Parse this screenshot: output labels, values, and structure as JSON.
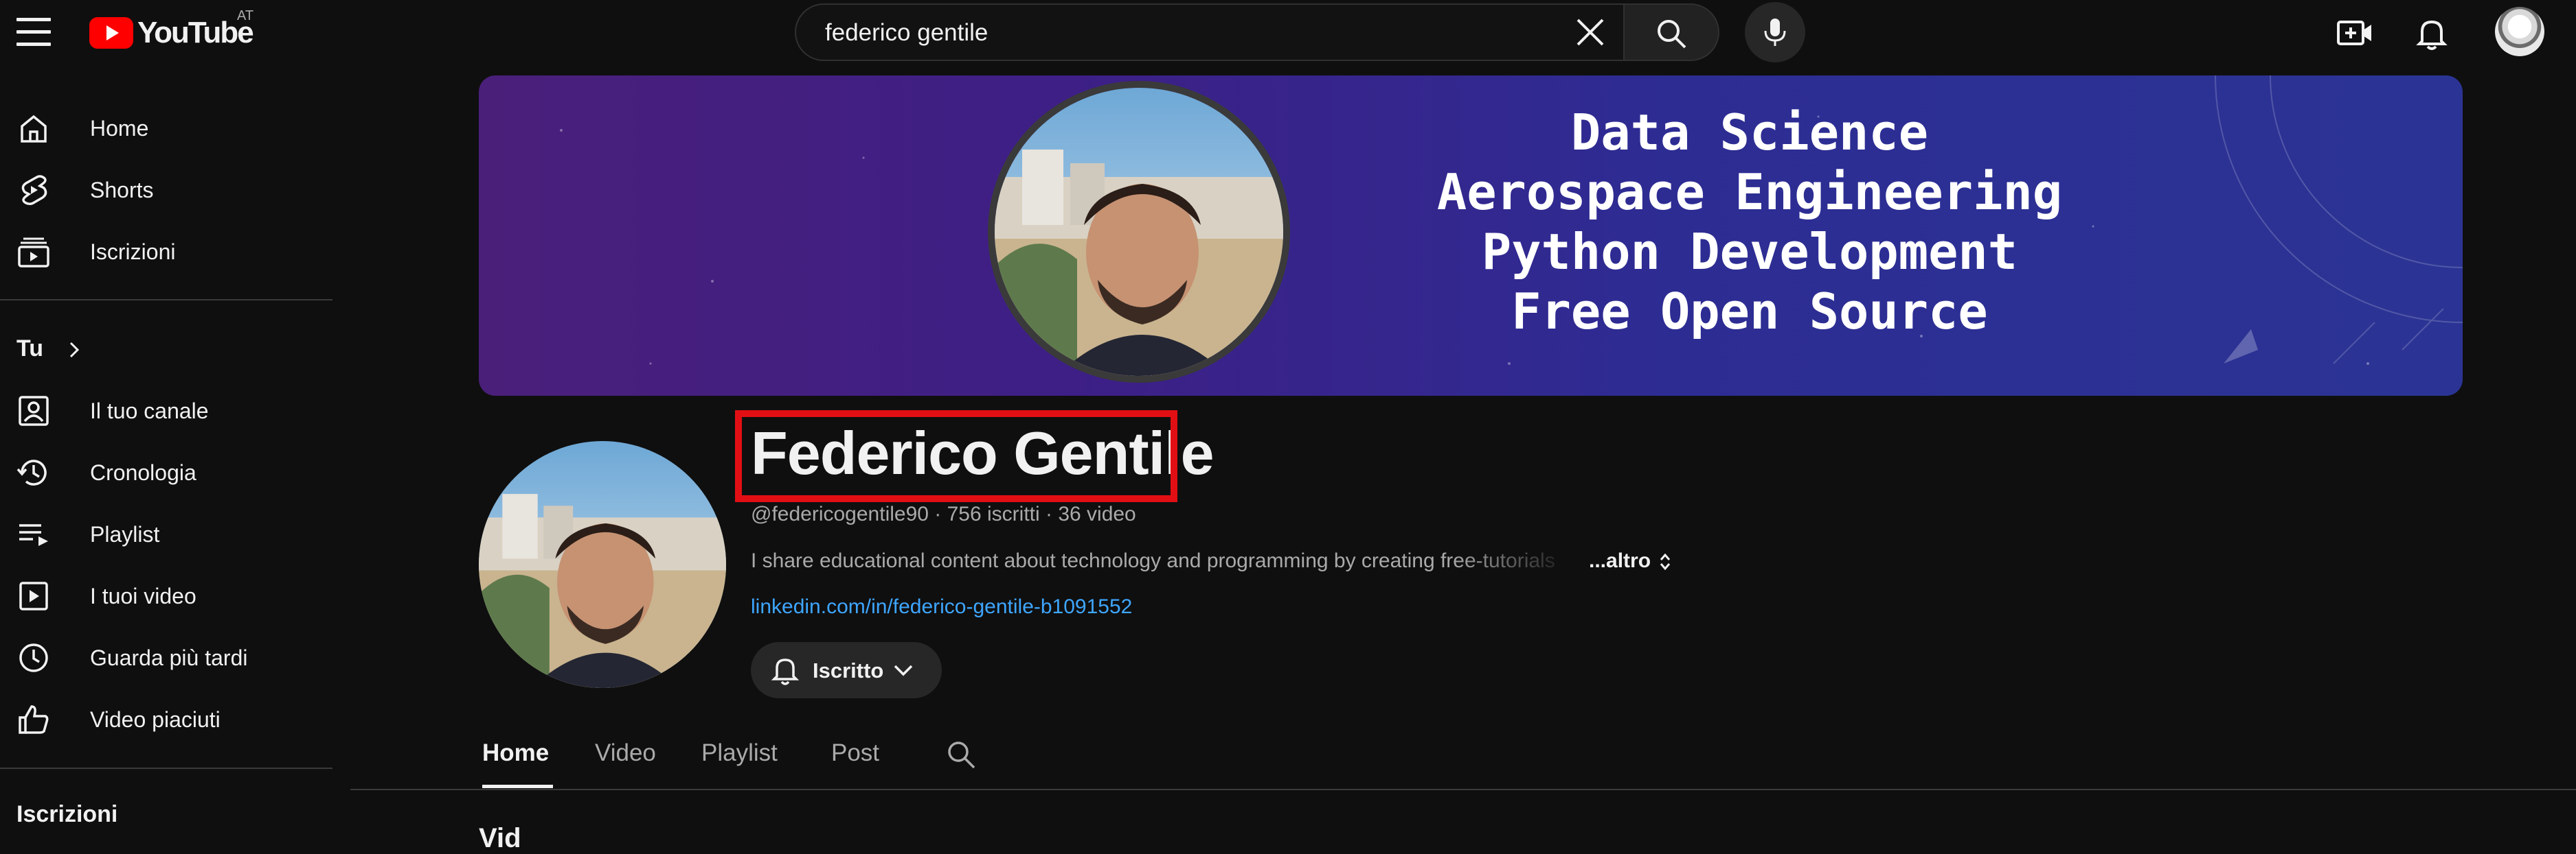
{
  "header": {
    "logo_text": "YouTube",
    "country_code": "AT",
    "search": {
      "value": "federico gentile",
      "placeholder": "Cerca"
    }
  },
  "sidebar": {
    "items_top": [
      {
        "label": "Home",
        "icon": "home-icon"
      },
      {
        "label": "Shorts",
        "icon": "shorts-icon"
      },
      {
        "label": "Iscrizioni",
        "icon": "subscriptions-icon"
      }
    ],
    "you_heading": "Tu",
    "items_you": [
      {
        "label": "Il tuo canale",
        "icon": "your-channel-icon"
      },
      {
        "label": "Cronologia",
        "icon": "history-icon"
      },
      {
        "label": "Playlist",
        "icon": "playlist-icon"
      },
      {
        "label": "I tuoi video",
        "icon": "your-videos-icon"
      },
      {
        "label": "Guarda più tardi",
        "icon": "watch-later-icon"
      },
      {
        "label": "Video piaciuti",
        "icon": "liked-videos-icon"
      }
    ],
    "subscriptions_heading": "Iscrizioni"
  },
  "banner": {
    "lines": [
      "Data Science",
      "Aerospace Engineering",
      "Python Development",
      "Free Open Source"
    ]
  },
  "channel": {
    "name": "Federico Gentile",
    "meta": "@federicogentile90 · 756 iscritti · 36 video",
    "description": "I share educational content about technology and programming by creating free-tutorials",
    "more_label": "...altro",
    "link": "linkedin.com/in/federico-gentile-b1091552",
    "subscribe_label": "Iscritto"
  },
  "tabs": [
    "Home",
    "Video",
    "Playlist",
    "Post"
  ],
  "section_title_peek": "Vid",
  "colors": {
    "background": "#0f0f0f",
    "highlight_box": "#e10f14",
    "link": "#3ea6ff",
    "brand_red": "#ff0000"
  }
}
